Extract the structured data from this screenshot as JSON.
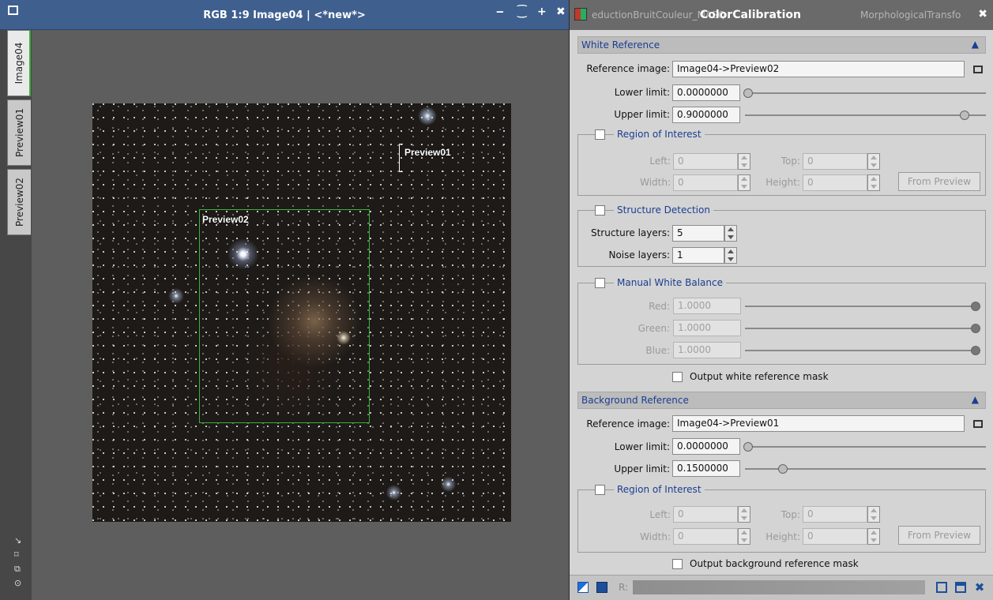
{
  "image_window": {
    "title": "RGB 1:9 Image04 | <*new*>",
    "controls": {
      "minimize": "‒",
      "shade": "⁐",
      "maximize": "+",
      "close": "✖"
    },
    "tabs": [
      {
        "label": "Image04"
      },
      {
        "label": "Preview01"
      },
      {
        "label": "Preview02"
      }
    ],
    "previews": [
      {
        "label": "Preview01"
      },
      {
        "label": "Preview02"
      }
    ],
    "strip_icons": [
      "↘",
      "⌑",
      "⧉",
      "⊙"
    ]
  },
  "panel": {
    "title": "ColorCalibration",
    "ghost_tabs": [
      "eductionBruitCouleur_MASQ",
      "MorphologicalTransfo"
    ],
    "close": "✖",
    "white_reference": {
      "title": "White Reference",
      "collapse": "▲",
      "reference_image_label": "Reference image:",
      "reference_image": "Image04->Preview02",
      "lower_limit_label": "Lower limit:",
      "lower_limit": "0.0000000",
      "upper_limit_label": "Upper limit:",
      "upper_limit": "0.9000000",
      "roi": {
        "title": "Region of Interest",
        "left_label": "Left:",
        "left": "0",
        "top_label": "Top:",
        "top": "0",
        "width_label": "Width:",
        "width": "0",
        "height_label": "Height:",
        "height": "0",
        "from_preview": "From Preview"
      },
      "structure": {
        "title": "Structure Detection",
        "layers_label": "Structure layers:",
        "layers": "5",
        "noise_label": "Noise layers:",
        "noise": "1"
      },
      "manual": {
        "title": "Manual White Balance",
        "red_label": "Red:",
        "red": "1.0000",
        "green_label": "Green:",
        "green": "1.0000",
        "blue_label": "Blue:",
        "blue": "1.0000"
      },
      "output_mask": "Output white reference mask"
    },
    "background_reference": {
      "title": "Background Reference",
      "collapse": "▲",
      "reference_image_label": "Reference image:",
      "reference_image": "Image04->Preview01",
      "lower_limit_label": "Lower limit:",
      "lower_limit": "0.0000000",
      "upper_limit_label": "Upper limit:",
      "upper_limit": "0.1500000",
      "roi": {
        "title": "Region of Interest",
        "left_label": "Left:",
        "left": "0",
        "top_label": "Top:",
        "top": "0",
        "width_label": "Width:",
        "width": "0",
        "height_label": "Height:",
        "height": "0",
        "from_preview": "From Preview"
      },
      "output_mask": "Output background reference mask"
    },
    "bottom_label": "R:"
  },
  "colors": {
    "title_blue": "#3f5f8f",
    "preview_green": "#3bb13b",
    "section_blue": "#1a3e91"
  }
}
